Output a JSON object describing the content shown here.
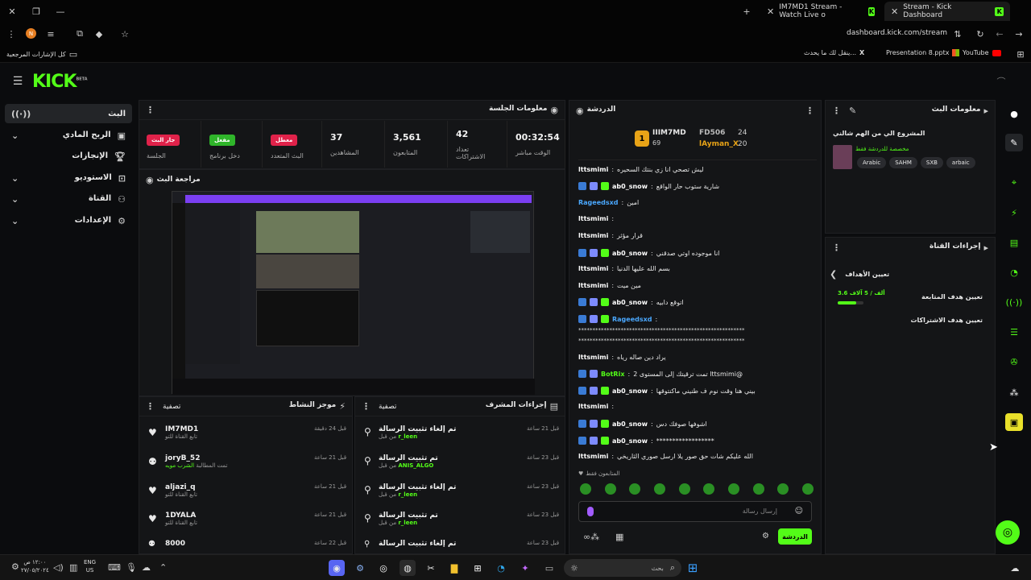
{
  "browser": {
    "tabs": [
      {
        "title": "IM7MD1 Stream - Watch Live o"
      },
      {
        "title": "Stream - Kick Dashboard"
      }
    ],
    "url": "dashboard.kick.com/stream",
    "bookmarks": {
      "all": "كل الإشارات المرجعية",
      "x": "ينقل لك ما يحدث...",
      "pptx": "Presentation 8.pptx",
      "youtube": "YouTube"
    },
    "profile_initial": "N"
  },
  "header": {
    "logo": "KICK",
    "logo_sup": "BETA"
  },
  "sidebar": {
    "items": [
      {
        "label": "البث",
        "icon": "live-icon",
        "active": true
      },
      {
        "label": "الربح المادي",
        "icon": "money-icon"
      },
      {
        "label": "الإنجازات",
        "icon": "trophy-icon"
      },
      {
        "label": "الاستوديو",
        "icon": "studio-icon"
      },
      {
        "label": "القناة",
        "icon": "channel-icon"
      },
      {
        "label": "الإعدادات",
        "icon": "gear-icon"
      }
    ]
  },
  "session": {
    "title": "معلومات الجلسة",
    "stats": [
      {
        "value": "00:32:54",
        "label": "الوقت مباشر"
      },
      {
        "value": "42",
        "label": "تعداد الاشتراكات"
      },
      {
        "value": "3,561",
        "label": "المتابعون"
      },
      {
        "value": "37",
        "label": "المشاهدين"
      }
    ],
    "badges": [
      {
        "text": "معطل",
        "label": "البث المتعدد",
        "color": "#e0224a"
      },
      {
        "text": "مفعل",
        "label": "دخل برنامج",
        "color": "#2fb52a"
      },
      {
        "text": "جار البث",
        "label": "الجلسة",
        "color": "#e0224a"
      }
    ]
  },
  "preview": {
    "title": "مراجعة البث"
  },
  "activity": {
    "title": "موجز النشاط",
    "filter": "تصفية",
    "rows": [
      {
        "name": "IM7MD1",
        "sub": "تابع القناة للتو",
        "time": "قبل 24 دقيقة"
      },
      {
        "name": "joryB_52",
        "sub": "تمت المطالبة",
        "sub2": "الشرب مويه",
        "time": "قبل 21 ساعة"
      },
      {
        "name": "aljazi_q",
        "sub": "تابع القناة للتو",
        "time": "قبل 21 ساعة"
      },
      {
        "name": "1DYALA",
        "sub": "تابع القناة للتو",
        "time": "قبل 21 ساعة"
      },
      {
        "name": "8000",
        "sub": "",
        "time": "قبل 22 ساعة"
      }
    ]
  },
  "modactions": {
    "title": "إجراءات المشرف",
    "filter": "تصفية",
    "rows": [
      {
        "action": "تم إلغاء تثبيت الرسالة",
        "by": "من قبل",
        "user": "r_leen",
        "time": "قبل 21 ساعة"
      },
      {
        "action": "تم تثبيت الرسالة",
        "by": "من قبل",
        "user": "ANIS_ALGO",
        "time": "قبل 23 ساعة"
      },
      {
        "action": "تم إلغاء تثبيت الرسالة",
        "by": "من قبل",
        "user": "r_leen",
        "time": "قبل 23 ساعة"
      },
      {
        "action": "تم تثبيت الرسالة",
        "by": "من قبل",
        "user": "r_leen",
        "time": "قبل 23 ساعة"
      },
      {
        "action": "تم إلغاء تثبيت الرسالة",
        "by": "",
        "user": "",
        "time": "قبل 23 ساعة"
      }
    ]
  },
  "chat": {
    "title": "الدردشة",
    "leaders": [
      {
        "rank": "1",
        "name": "IIIM7MD",
        "points": "69"
      },
      {
        "name": "FD506",
        "points": "24"
      },
      {
        "name": "lAyman_X",
        "points": "20"
      }
    ],
    "messages": [
      {
        "user": "lttsmimi",
        "text": "ليش تصحي انا زي بنتك السحيره",
        "color": "#ffffff",
        "badges": 0
      },
      {
        "user": "ab0_snow",
        "text": "شارية ستوب حار الواقع",
        "color": "#ffffff",
        "badges": 3
      },
      {
        "user": "Rageedsxd",
        "text": "امين",
        "color": "#4aa8ff",
        "badges": 0
      },
      {
        "user": "lttsmimi",
        "text": "",
        "color": "#ffffff",
        "badges": 0
      },
      {
        "user": "lttsmimi",
        "text": "قرار مؤثر",
        "color": "#ffffff",
        "badges": 0
      },
      {
        "user": "ab0_snow",
        "text": "انا موجوده اوتي صدقني",
        "color": "#ffffff",
        "badges": 3
      },
      {
        "user": "lttsmimi",
        "text": "بسم الله عليها الدنيا",
        "color": "#ffffff",
        "badges": 0
      },
      {
        "user": "lttsmimi",
        "text": "مين ميت",
        "color": "#ffffff",
        "badges": 0
      },
      {
        "user": "ab0_snow",
        "text": "اتوقع دابيه",
        "color": "#ffffff",
        "badges": 3
      },
      {
        "user": "Rageedsxd",
        "text": "",
        "color": "#4aa8ff",
        "badges": 3
      },
      {
        "user": "lttsmimi",
        "text": "يراد دين صاله رياه",
        "color": "#ffffff",
        "badges": 0
      },
      {
        "user": "BotRix",
        "text": "@lttsmimi تمت ترقيتك إلى المستوى 2",
        "color": "#53fc18",
        "badges": 2
      },
      {
        "user": "ab0_snow",
        "text": "بيني هنا وقت نوم ف طنيني ماكنتوقها",
        "color": "#ffffff",
        "badges": 3
      },
      {
        "user": "lttsmimi",
        "text": "",
        "color": "#ffffff",
        "badges": 0
      },
      {
        "user": "ab0_snow",
        "text": "اشوفها صوفك دس",
        "color": "#ffffff",
        "badges": 3
      },
      {
        "user": "ab0_snow",
        "text": "******************",
        "color": "#ffffff",
        "badges": 3
      },
      {
        "user": "lttsmimi",
        "text": "الله عليكم شات حق صور يلا ارسل صوري الثاريخي",
        "color": "#ffffff",
        "badges": 0
      }
    ],
    "spam_line": "***********************************************************",
    "followers_only": "المتابعون فقط",
    "placeholder": "إرسال رسالة",
    "send_label": "الدردشة"
  },
  "streaminfo": {
    "title": "معلومات البث",
    "stream_title": "المشروع الي من الهم شالني",
    "category": "مخصصة للدردشة فقط",
    "tags": [
      "Arabic",
      "SAHM",
      "SXB",
      "arbaic"
    ]
  },
  "channelactions": {
    "title": "إجراءات القناة",
    "back_title": "تعيين الأهداف",
    "goal_text": "3.6 ألف / 5 آلاف",
    "goal_fraction": 0.72,
    "items": [
      "تعيين هدف المتابعة",
      "تعيين هدف الاشتراكات"
    ]
  },
  "taskbar": {
    "time": "١٢:٠٠ ص",
    "date": "٢٧/٠٥/٢٠٢٤",
    "lang": "ENG",
    "region": "US",
    "search_placeholder": "بحث"
  }
}
